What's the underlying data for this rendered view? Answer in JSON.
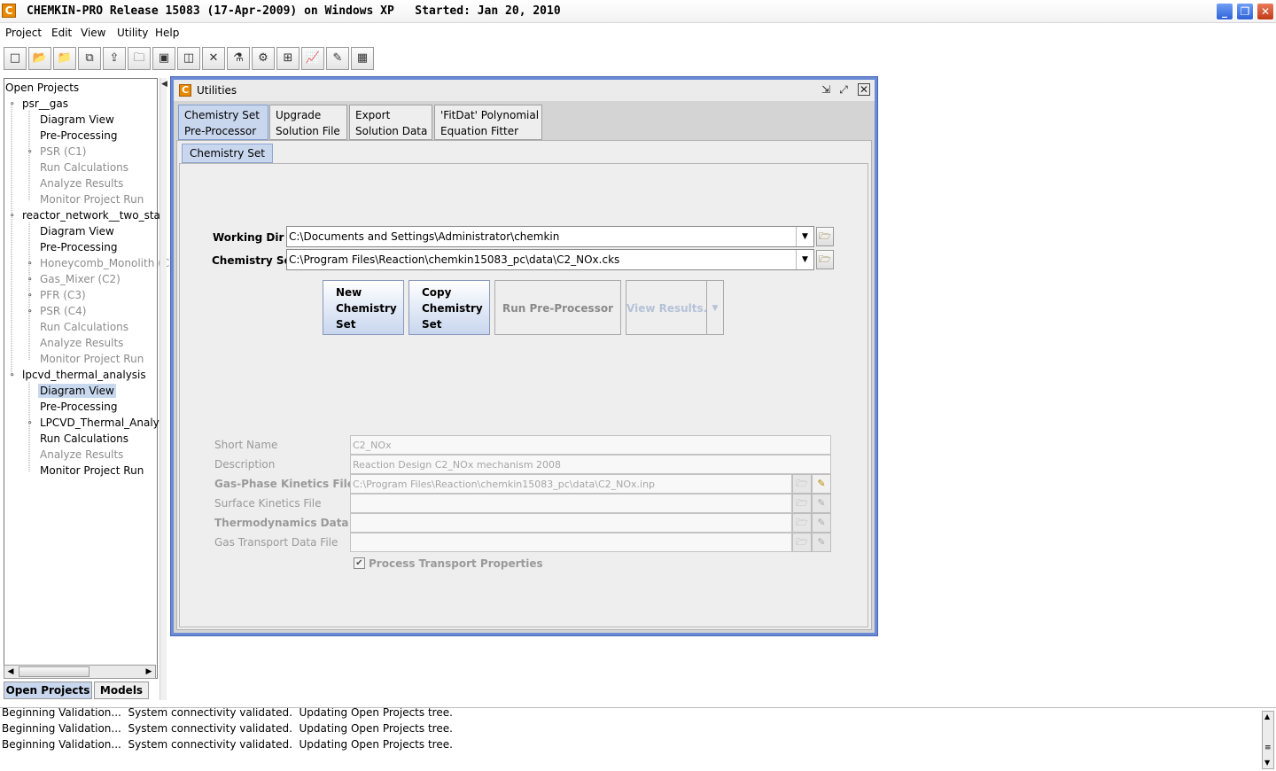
{
  "app": {
    "title": "CHEMKIN-PRO Release 15083 (17-Apr-2009) on Windows XP   Started: Jan 20, 2010",
    "icon": "chemkin-logo-icon"
  },
  "menu": [
    "Project",
    "Edit",
    "View",
    "Utility",
    "Help"
  ],
  "toolbar_icons": [
    "new-file-icon",
    "open-folder-icon",
    "open-project-icon",
    "copy-icon",
    "import-icon",
    "folder-icon",
    "save-icon",
    "save-all-icon",
    "close-icon",
    "chemistry-icon",
    "reactor-icon",
    "network-icon",
    "graph-icon",
    "edit-graph-icon",
    "image-icon"
  ],
  "tree": {
    "root": "Open Projects",
    "projects": [
      {
        "name": "psr__gas",
        "children": [
          "Diagram View",
          "Pre-Processing",
          "PSR (C1)",
          "Run Calculations",
          "Analyze Results",
          "Monitor Project Run"
        ]
      },
      {
        "name": "reactor_network__two_stag",
        "children": [
          "Diagram View",
          "Pre-Processing",
          "Honeycomb_Monolith (C",
          "Gas_Mixer (C2)",
          "PFR (C3)",
          "PSR (C4)",
          "Run Calculations",
          "Analyze Results",
          "Monitor Project Run"
        ]
      },
      {
        "name": "lpcvd_thermal_analysis",
        "children": [
          "Diagram View",
          "Pre-Processing",
          "LPCVD_Thermal_Analyz",
          "Run Calculations",
          "Analyze Results",
          "Monitor Project Run"
        ]
      }
    ]
  },
  "left_tabs": [
    "Open Projects",
    "Models"
  ],
  "utilities": {
    "title": "Utilities",
    "tabs": [
      "Chemistry Set\nPre-Processor",
      "Upgrade\nSolution File",
      "Export\nSolution Data",
      "'FitDat' Polynomial\nEquation Fitter"
    ],
    "sub_tab": "Chemistry Set",
    "working_dir_label": "Working Dir",
    "working_dir_value": "C:\\Documents and Settings\\Administrator\\chemkin",
    "chemistry_set_label": "Chemistry Set",
    "chemistry_set_value": "C:\\Program Files\\Reaction\\chemkin15083_pc\\data\\C2_NOx.cks",
    "buttons": {
      "new_chemistry_set": "New\nChemistry\nSet",
      "copy_chemistry_set": "Copy\nChemistry\nSet",
      "run_preprocessor": "Run Pre-Processor",
      "view_results": "View Results..."
    },
    "fields": {
      "short_name_label": "Short Name",
      "short_name_value": "C2_NOx",
      "description_label": "Description",
      "description_value": "Reaction Design C2_NOx mechanism 2008",
      "gas_kinetics_label": "Gas-Phase Kinetics File",
      "gas_kinetics_value": "C:\\Program Files\\Reaction\\chemkin15083_pc\\data\\C2_NOx.inp",
      "surface_kinetics_label": "Surface Kinetics File",
      "surface_kinetics_value": "",
      "thermo_label": "Thermodynamics Data File",
      "thermo_value": "",
      "transport_label": "Gas Transport Data File",
      "transport_value": ""
    },
    "process_transport_label": "Process Transport Properties",
    "process_transport_checked": true
  },
  "log": [
    "Beginning Validation...  System connectivity validated.  Updating Open Projects tree.",
    "Beginning Validation...  System connectivity validated.  Updating Open Projects tree.",
    "Beginning Validation...  System connectivity validated.  Updating Open Projects tree."
  ]
}
